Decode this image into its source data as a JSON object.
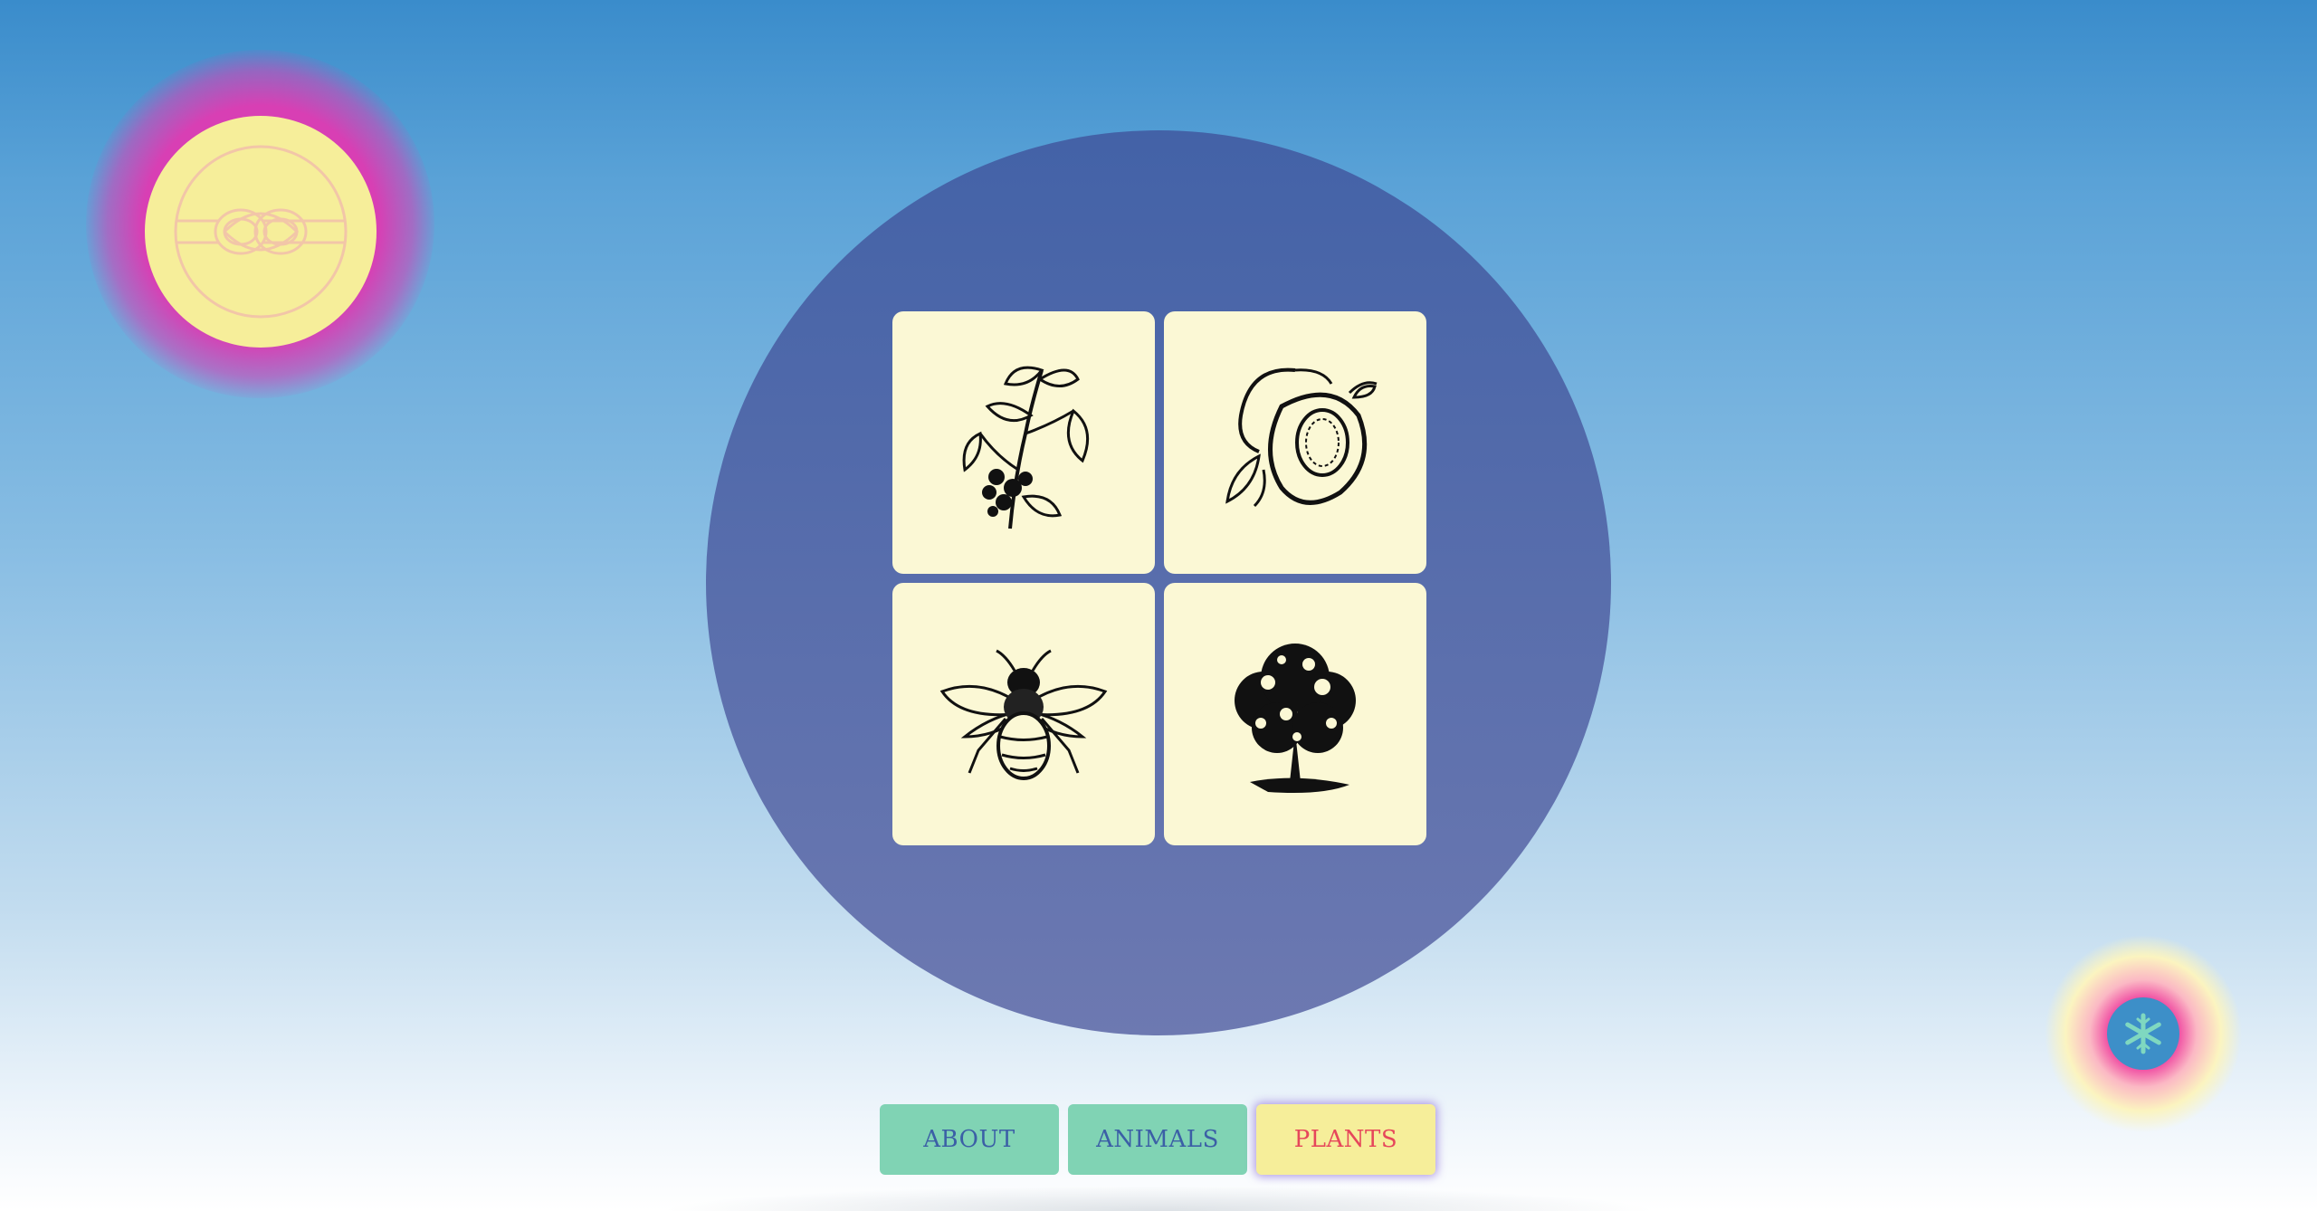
{
  "logo": {
    "icon": "sailor-knot-icon",
    "accent": "#f2c6a8"
  },
  "cards": [
    {
      "name": "blueberry-branch",
      "icon": "blueberry-branch-icon"
    },
    {
      "name": "peach",
      "icon": "peach-icon"
    },
    {
      "name": "bee",
      "icon": "bee-icon"
    },
    {
      "name": "tree",
      "icon": "tree-icon"
    }
  ],
  "nav": {
    "items": [
      {
        "label": "ABOUT",
        "active": false
      },
      {
        "label": "ANIMALS",
        "active": false
      },
      {
        "label": "PLANTS",
        "active": true
      }
    ]
  },
  "corner_button": {
    "icon": "snowflake-icon"
  },
  "colors": {
    "stage": "#4a66a8",
    "card": "#fbf8d5",
    "nav_button": "#80d3b4",
    "nav_active": "#f6ee9a",
    "nav_text": "#3b5fa6",
    "nav_active_text": "#e6475b",
    "glow_pink": "#d83fb4"
  }
}
